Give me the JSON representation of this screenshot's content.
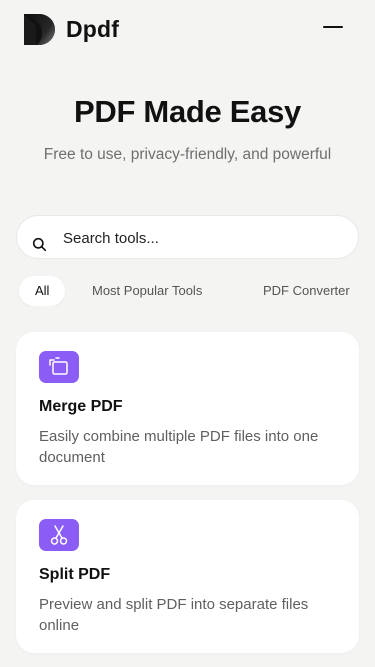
{
  "header": {
    "brand": "Dpdf",
    "logo_icon": "dpdf-logo-icon",
    "menu_icon": "hamburger-menu-icon"
  },
  "hero": {
    "title": "PDF Made Easy",
    "subtitle": "Free to use, privacy-friendly, and powerful"
  },
  "search": {
    "placeholder": "Search tools...",
    "value": "",
    "icon": "search-icon"
  },
  "filters": [
    {
      "label": "All",
      "active": true
    },
    {
      "label": "Most Popular Tools",
      "active": false
    },
    {
      "label": "PDF Converter",
      "active": false
    }
  ],
  "tools": [
    {
      "title": "Merge PDF",
      "description": "Easily combine multiple PDF files into one document",
      "icon": "merge-icon"
    },
    {
      "title": "Split PDF",
      "description": "Preview and split PDF into separate files online",
      "icon": "scissors-icon"
    }
  ],
  "colors": {
    "accent": "#8b5cf6",
    "background": "#f4f4f2",
    "card": "#ffffff",
    "text": "#111111",
    "muted": "#6f6f6f"
  }
}
